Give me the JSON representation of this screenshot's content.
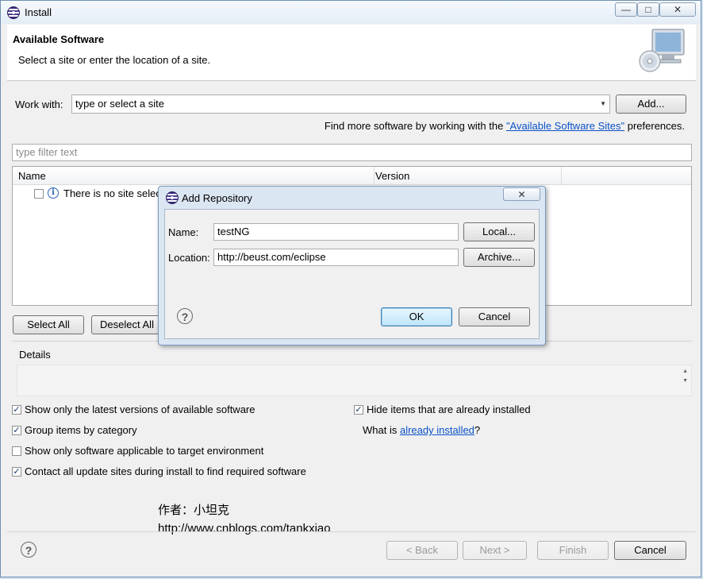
{
  "window": {
    "title": "Install",
    "min": "—",
    "max": "□",
    "close": "✕"
  },
  "header": {
    "title": "Available Software",
    "subtitle": "Select a site or enter the location of a site."
  },
  "work_with": {
    "label": "Work with:",
    "value": "type or select a site",
    "add_label": "Add...",
    "find_prefix": "Find more software by working with the ",
    "find_link": "\"Available Software Sites\"",
    "find_suffix": " preferences."
  },
  "filter": {
    "placeholder": "type filter text"
  },
  "table": {
    "columns": [
      "Name",
      "Version"
    ],
    "rows": [
      {
        "text": "There is no site selec"
      }
    ]
  },
  "buttons": {
    "select_all": "Select All",
    "deselect_all": "Deselect All"
  },
  "details": {
    "label": "Details"
  },
  "options": [
    {
      "label": "Show only the latest versions of available software",
      "checked": true
    },
    {
      "label": "Group items by category",
      "checked": true
    },
    {
      "label": "Show only software applicable to target environment",
      "checked": false
    },
    {
      "label": "Contact all update sites during install to find required software",
      "checked": true
    }
  ],
  "hide_installed": {
    "label": "Hide items that are already installed",
    "checked": true
  },
  "what_is": {
    "prefix": "What is ",
    "link": "already installed",
    "suffix": "?"
  },
  "watermark": {
    "author": "作者：小坦克",
    "url": "http://www.cnblogs.com/tankxiao"
  },
  "footer": {
    "back": "< Back",
    "next": "Next >",
    "finish": "Finish",
    "cancel": "Cancel"
  },
  "dialog": {
    "title": "Add Repository",
    "close": "✕",
    "name_label": "Name:",
    "name_value": "testNG",
    "local_label": "Local...",
    "location_label": "Location:",
    "location_value": "http://beust.com/eclipse",
    "archive_label": "Archive...",
    "ok": "OK",
    "cancel": "Cancel"
  },
  "icons": {
    "help": "?",
    "info": "i",
    "check": "✓",
    "dropdown": "▼",
    "scroll_up": "▲",
    "scroll_down": "▼"
  }
}
